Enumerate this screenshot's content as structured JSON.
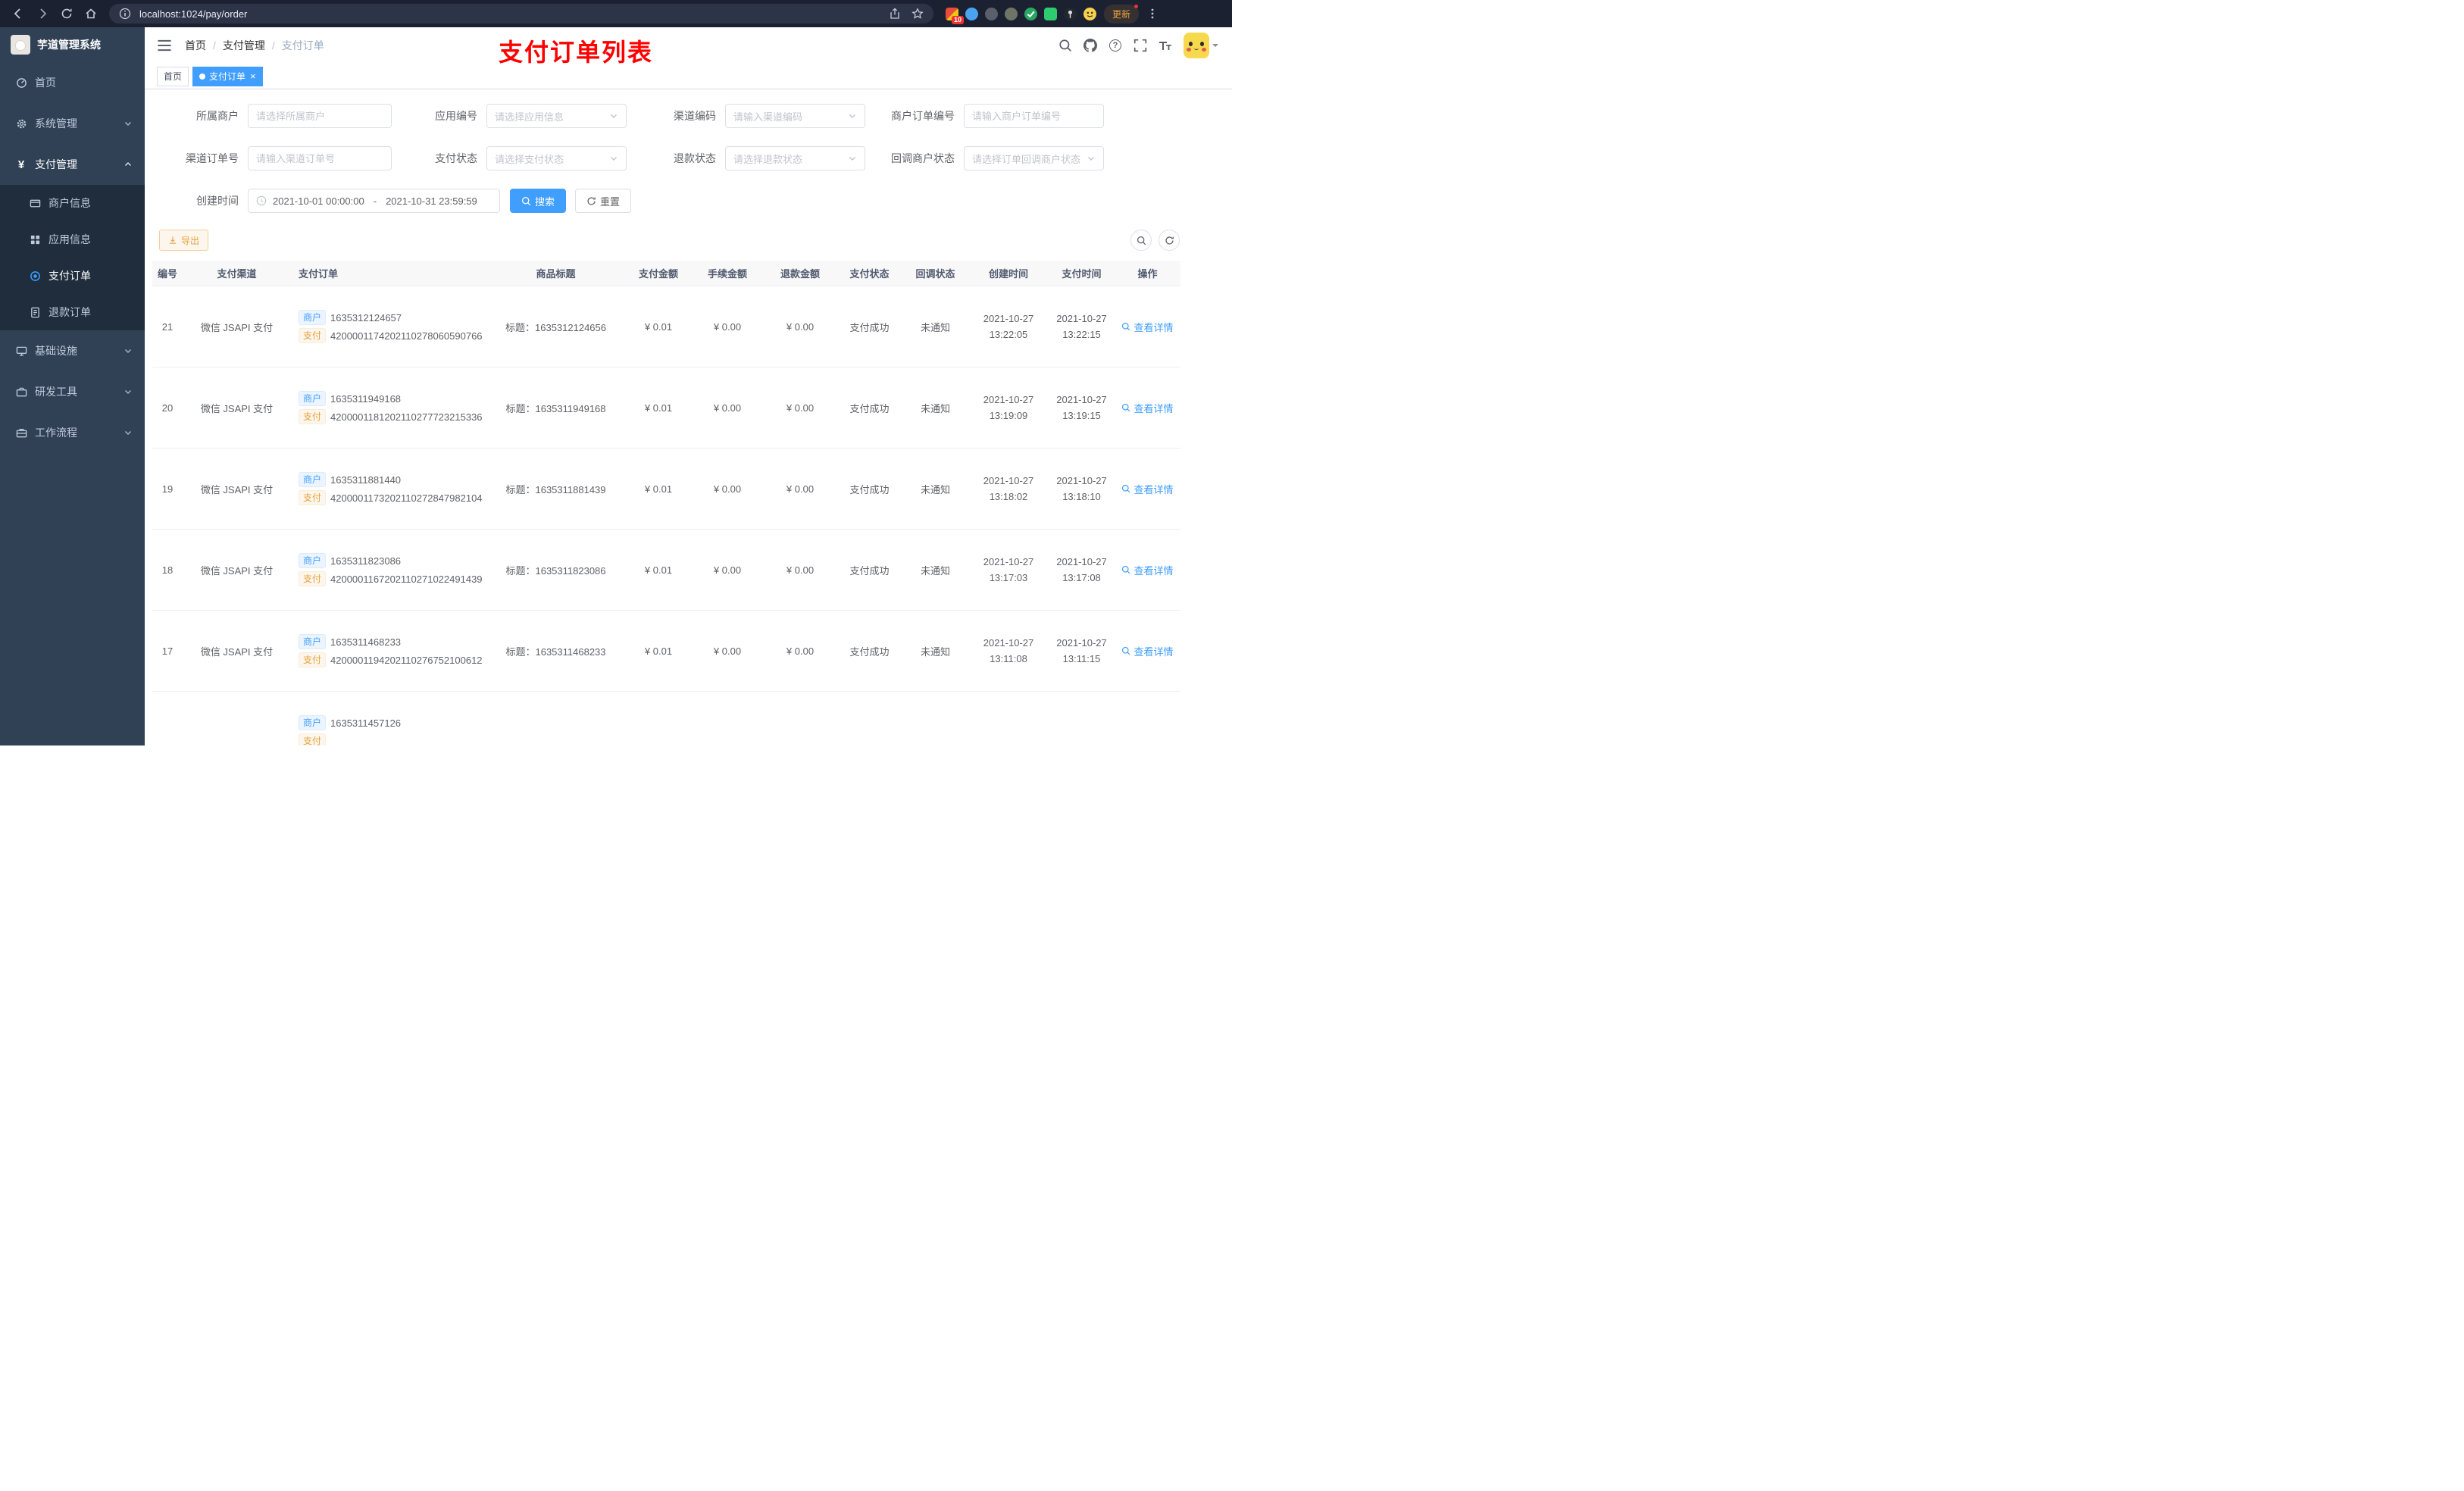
{
  "browser": {
    "url": "localhost:1024/pay/order",
    "update_label": "更新",
    "extension_badge": "10"
  },
  "icons": {
    "yen": "¥",
    "question": "?"
  },
  "sidebar": {
    "title": "芋道管理系统",
    "menu": [
      {
        "label": "首页"
      },
      {
        "label": "系统管理"
      },
      {
        "label": "支付管理"
      },
      {
        "label": "基础设施"
      },
      {
        "label": "研发工具"
      },
      {
        "label": "工作流程"
      }
    ],
    "submenu": [
      {
        "label": "商户信息"
      },
      {
        "label": "应用信息"
      },
      {
        "label": "支付订单"
      },
      {
        "label": "退款订单"
      }
    ]
  },
  "header": {
    "breadcrumb": {
      "items": [
        "首页",
        "支付管理",
        "支付订单"
      ],
      "separator": "/"
    },
    "annotation": "支付订单列表"
  },
  "tags_view": {
    "tabs": [
      {
        "label": "首页"
      },
      {
        "label": "支付订单"
      }
    ],
    "close_glyph": "×"
  },
  "filters": {
    "merchant": {
      "label": "所属商户",
      "placeholder": "请选择所属商户"
    },
    "app": {
      "label": "应用编号",
      "placeholder": "请选择应用信息"
    },
    "channel_code": {
      "label": "渠道编码",
      "placeholder": "请输入渠道编码"
    },
    "merchant_order_no": {
      "label": "商户订单编号",
      "placeholder": "请输入商户订单编号"
    },
    "channel_order_no": {
      "label": "渠道订单号",
      "placeholder": "请输入渠道订单号"
    },
    "pay_status": {
      "label": "支付状态",
      "placeholder": "请选择支付状态"
    },
    "refund_status": {
      "label": "退款状态",
      "placeholder": "请选择退款状态"
    },
    "callback_status": {
      "label": "回调商户状态",
      "placeholder": "请选择订单回调商户状态"
    },
    "create_time": {
      "label": "创建时间",
      "start": "2021-10-01 00:00:00",
      "separator": "-",
      "end": "2021-10-31 23:59:59"
    },
    "search_label": "搜索",
    "reset_label": "重置"
  },
  "toolbar": {
    "export_label": "导出"
  },
  "table": {
    "columns": [
      "编号",
      "支付渠道",
      "支付订单",
      "商品标题",
      "支付金额",
      "手续金额",
      "退款金额",
      "支付状态",
      "回调状态",
      "创建时间",
      "支付时间",
      "操作"
    ],
    "merchant_tag": "商户",
    "pay_tag": "支付",
    "action_label": "查看详情",
    "rows": [
      {
        "id": "21",
        "channel": "微信 JSAPI 支付",
        "merchant_no": "1635312124657",
        "pay_no": "4200001174202110278060590766",
        "title": "标题：1635312124656",
        "amount": "¥ 0.01",
        "fee": "¥ 0.00",
        "refund": "¥ 0.00",
        "status": "支付成功",
        "notify": "未通知",
        "create_date": "2021-10-27",
        "create_time": "13:22:05",
        "pay_date": "2021-10-27",
        "pay_time": "13:22:15"
      },
      {
        "id": "20",
        "channel": "微信 JSAPI 支付",
        "merchant_no": "1635311949168",
        "pay_no": "4200001181202110277723215336",
        "title": "标题：1635311949168",
        "amount": "¥ 0.01",
        "fee": "¥ 0.00",
        "refund": "¥ 0.00",
        "status": "支付成功",
        "notify": "未通知",
        "create_date": "2021-10-27",
        "create_time": "13:19:09",
        "pay_date": "2021-10-27",
        "pay_time": "13:19:15"
      },
      {
        "id": "19",
        "channel": "微信 JSAPI 支付",
        "merchant_no": "1635311881440",
        "pay_no": "4200001173202110272847982104",
        "title": "标题：1635311881439",
        "amount": "¥ 0.01",
        "fee": "¥ 0.00",
        "refund": "¥ 0.00",
        "status": "支付成功",
        "notify": "未通知",
        "create_date": "2021-10-27",
        "create_time": "13:18:02",
        "pay_date": "2021-10-27",
        "pay_time": "13:18:10"
      },
      {
        "id": "18",
        "channel": "微信 JSAPI 支付",
        "merchant_no": "1635311823086",
        "pay_no": "4200001167202110271022491439",
        "title": "标题：1635311823086",
        "amount": "¥ 0.01",
        "fee": "¥ 0.00",
        "refund": "¥ 0.00",
        "status": "支付成功",
        "notify": "未通知",
        "create_date": "2021-10-27",
        "create_time": "13:17:03",
        "pay_date": "2021-10-27",
        "pay_time": "13:17:08"
      },
      {
        "id": "17",
        "channel": "微信 JSAPI 支付",
        "merchant_no": "1635311468233",
        "pay_no": "4200001194202110276752100612",
        "title": "标题：1635311468233",
        "amount": "¥ 0.01",
        "fee": "¥ 0.00",
        "refund": "¥ 0.00",
        "status": "支付成功",
        "notify": "未通知",
        "create_date": "2021-10-27",
        "create_time": "13:11:08",
        "pay_date": "2021-10-27",
        "pay_time": "13:11:15"
      },
      {
        "id": "",
        "channel": "",
        "merchant_no": "1635311457126",
        "pay_no": "",
        "title": "",
        "amount": "",
        "fee": "",
        "refund": "",
        "status": "",
        "notify": "",
        "create_date": "",
        "create_time": "",
        "pay_date": "",
        "pay_time": ""
      }
    ]
  }
}
